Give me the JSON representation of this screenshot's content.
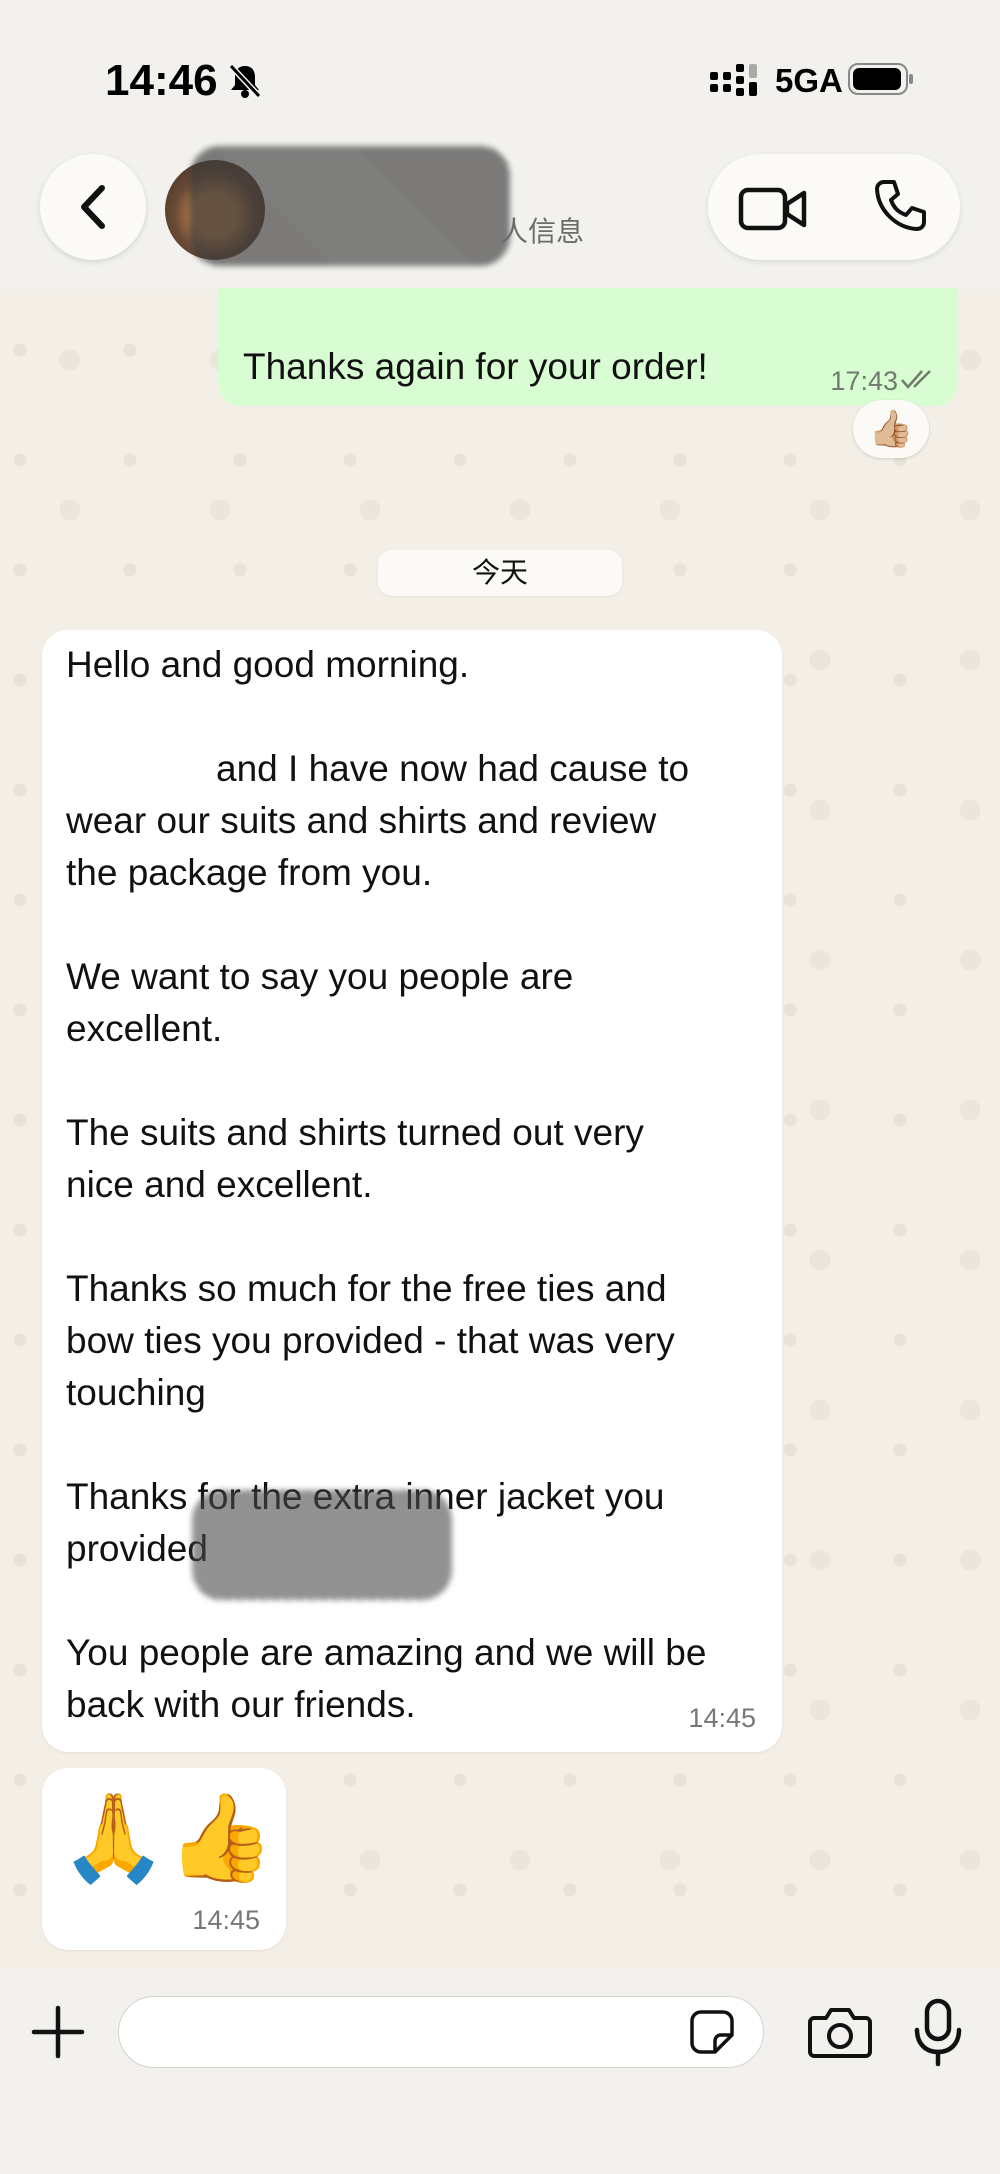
{
  "status_bar": {
    "time": "14:46",
    "network": "5GA"
  },
  "header": {
    "contact_status": "人信息"
  },
  "messages": {
    "outgoing": {
      "text": "Thanks again for your order!",
      "time": "17:43",
      "reaction": "👍🏼"
    },
    "date_divider": "今天",
    "incoming": {
      "lines": [
        "Hello and good morning.",
        "",
        "and I have now had cause to",
        "wear our suits and shirts and review",
        "the package from you.",
        "",
        "We want to say you people are",
        "excellent.",
        "",
        "The suits and shirts turned out very",
        "nice and excellent.",
        "",
        "Thanks so much for the free ties and",
        "bow ties you provided - that was very",
        "touching",
        "",
        "Thanks for the extra inner jacket you",
        "provided",
        "",
        "You people are amazing and we will be",
        "back with our friends."
      ],
      "time": "14:45"
    },
    "emoji_message": {
      "text": "🙏👍",
      "time": "14:45"
    }
  },
  "colors": {
    "outgoing_bubble": "#d9fdd3",
    "incoming_bubble": "#ffffff",
    "chat_background": "#f4efe6"
  }
}
